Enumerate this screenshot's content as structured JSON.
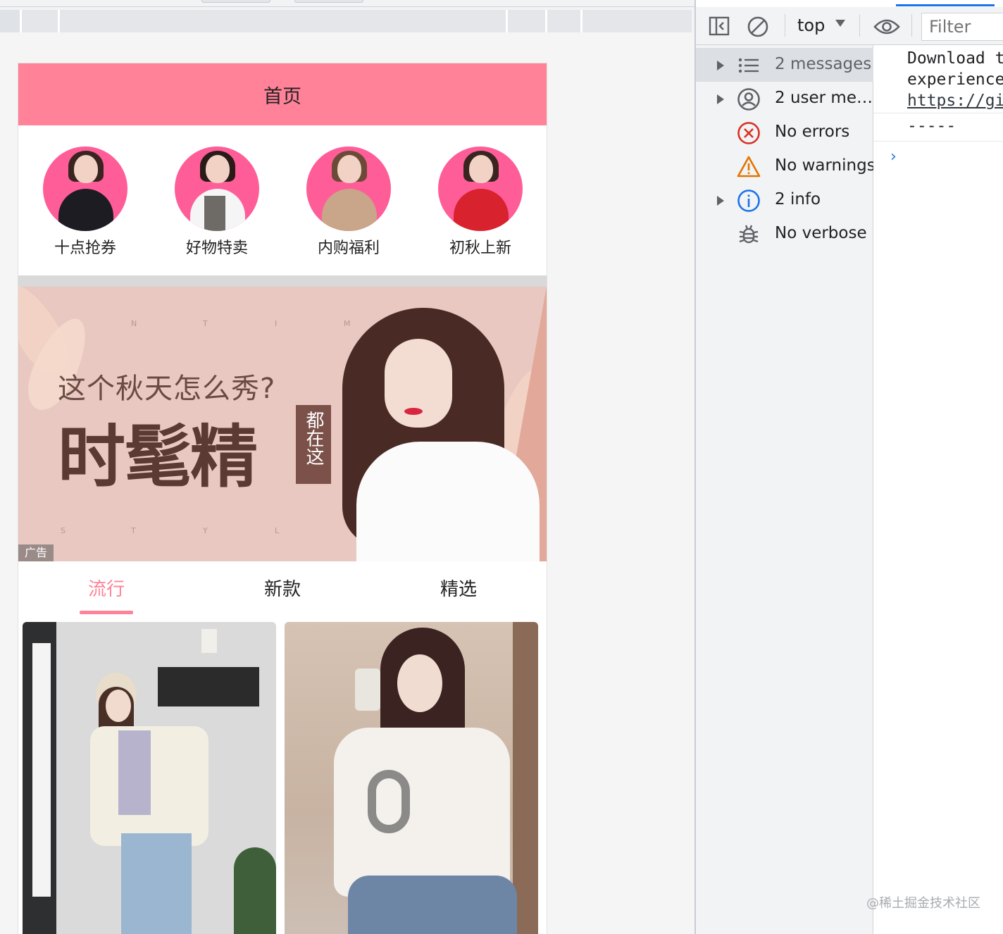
{
  "navbar": {
    "title": "首页"
  },
  "recommend": [
    {
      "label": "十点抢券"
    },
    {
      "label": "好物特卖"
    },
    {
      "label": "内购福利"
    },
    {
      "label": "初秋上新"
    }
  ],
  "banner": {
    "letters_top": [
      "N",
      "T",
      "I",
      "M"
    ],
    "letters_bottom": [
      "S",
      "T",
      "Y",
      "L"
    ],
    "small_text": "这个秋天怎么秀?",
    "big_text": "时髦精",
    "tag_text": "都在这",
    "ad_label": "广告"
  },
  "tabs": [
    {
      "label": "流行"
    },
    {
      "label": "新款"
    },
    {
      "label": "精选"
    }
  ],
  "tab_active_index": 0,
  "devtools": {
    "context": "top",
    "filter_placeholder": "Filter",
    "sidebar": [
      {
        "label": "2 messages",
        "icon": "list-icon",
        "expandable": true,
        "selected": true
      },
      {
        "label": "2 user me…",
        "icon": "user-icon",
        "expandable": true,
        "selected": false
      },
      {
        "label": "No errors",
        "icon": "error-icon",
        "expandable": false,
        "selected": false
      },
      {
        "label": "No warnings",
        "icon": "warning-icon",
        "expandable": false,
        "selected": false
      },
      {
        "label": "2 info",
        "icon": "info-icon",
        "expandable": true,
        "selected": false
      },
      {
        "label": "No verbose",
        "icon": "bug-icon",
        "expandable": false,
        "selected": false
      }
    ],
    "console_lines": {
      "line1": "Download t",
      "line2": "experience",
      "link": "https://gi",
      "line4": "-----",
      "prompt": "›"
    }
  },
  "watermark": "@稀土掘金技术社区",
  "colors": {
    "accent_pink": "#ff8298",
    "avatar_pink": "#ff5d98",
    "devtools_blue": "#1a73e8",
    "error_red": "#d93025",
    "warning_orange": "#e37400"
  }
}
